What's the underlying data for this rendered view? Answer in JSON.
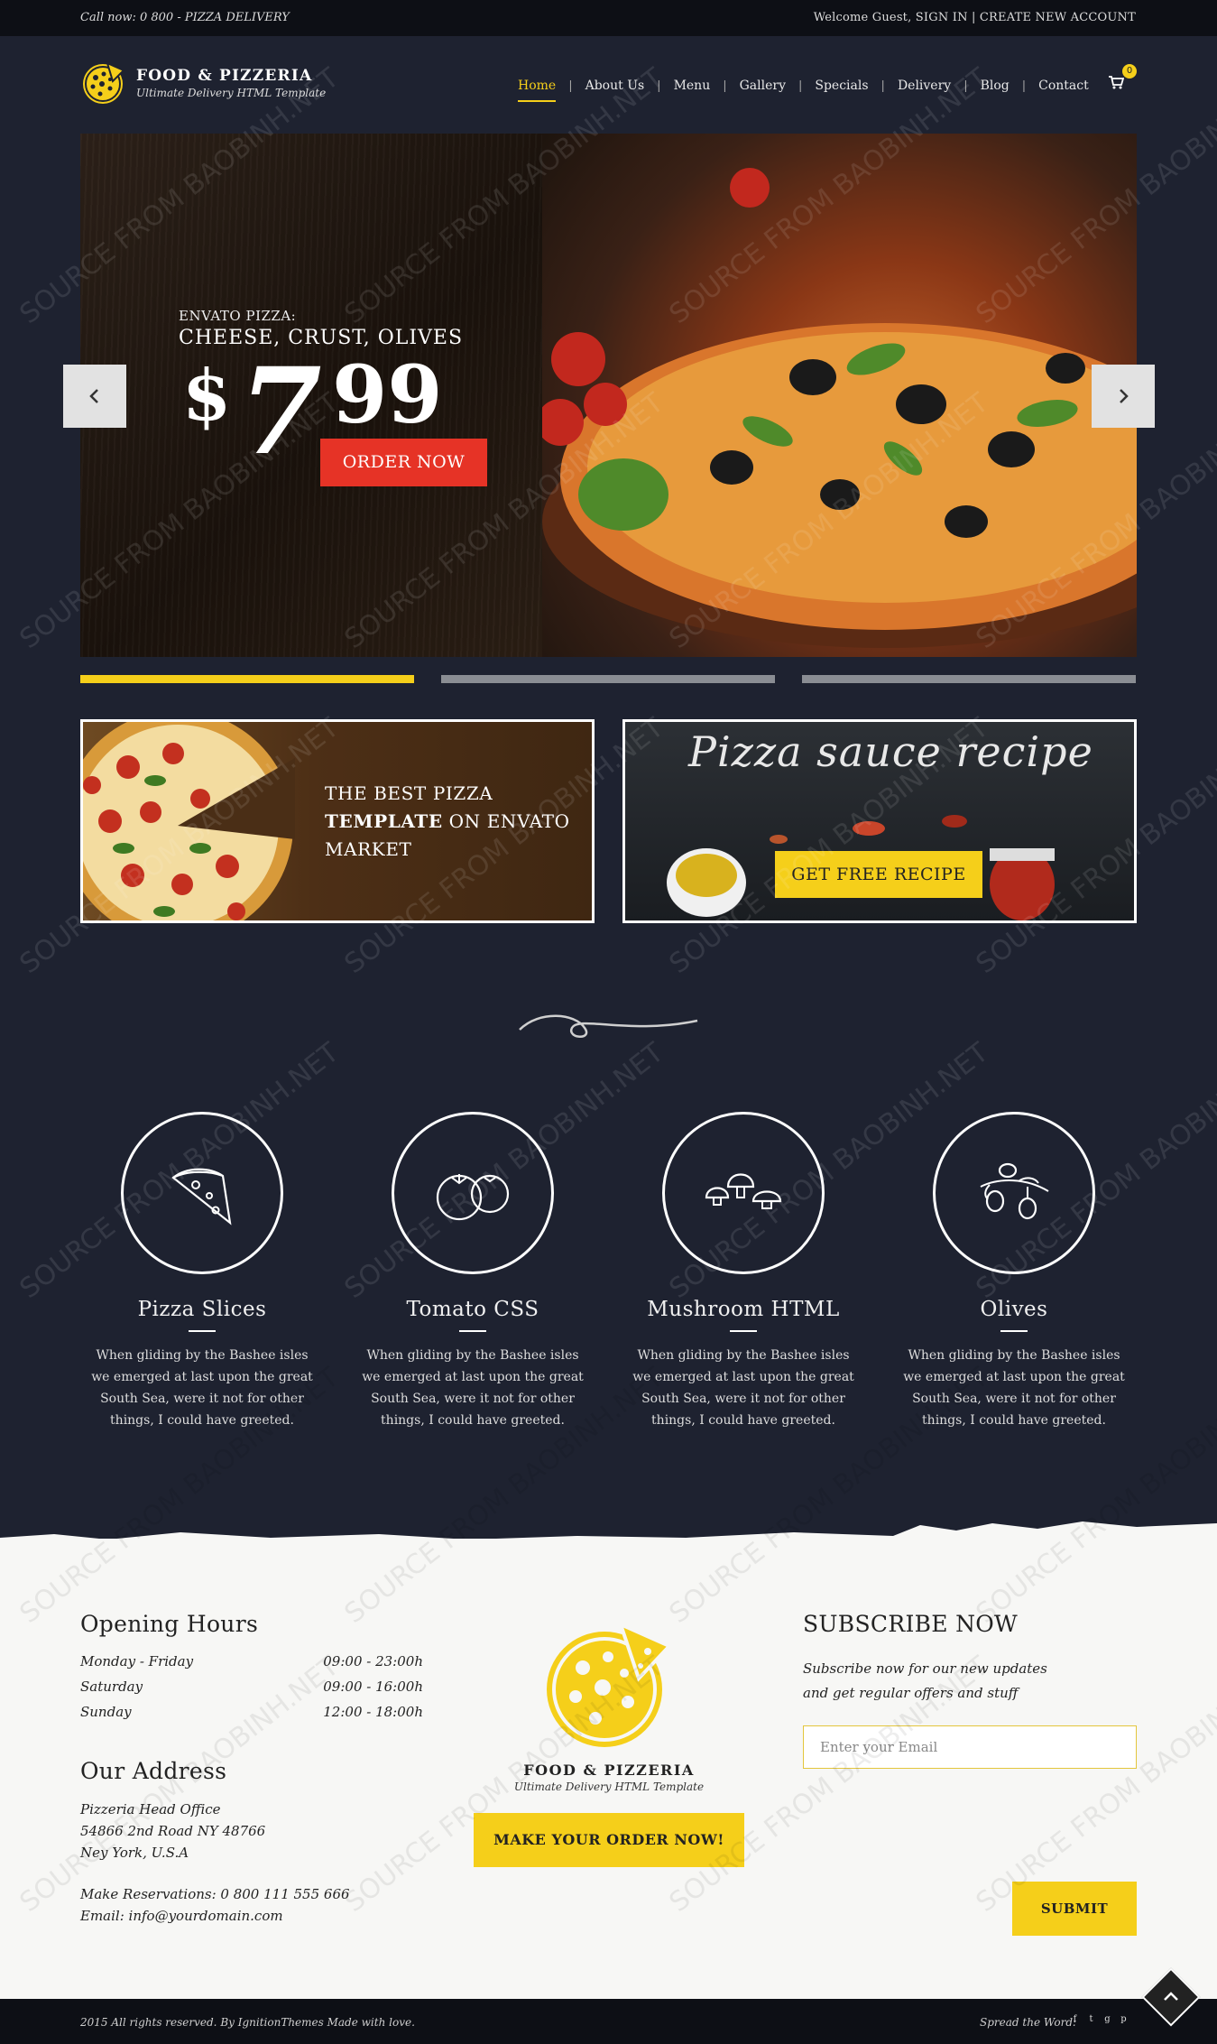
{
  "topbar": {
    "call": "Call now: 0 800 - PIZZA DELIVERY",
    "welcome": "Welcome Guest,",
    "sign_in": "SIGN IN",
    "separator": " | ",
    "create_account": "CREATE NEW ACCOUNT"
  },
  "header": {
    "brand_name": "FOOD & PIZZERIA",
    "brand_tagline": "Ultimate Delivery HTML Template",
    "nav": [
      "Home",
      "About Us",
      "Menu",
      "Gallery",
      "Specials",
      "Delivery",
      "Blog",
      "Contact"
    ],
    "active_nav": "Home",
    "cart_count": "0"
  },
  "hero": {
    "pretitle": "ENVATO PIZZA:",
    "title": "CHEESE, CRUST, OLIVES",
    "currency": "$",
    "price_main": "7",
    "price_cents": "99",
    "cta": "ORDER NOW",
    "active_slide": 1,
    "slide_count": 3
  },
  "promos": {
    "best_line1": "THE BEST PIZZA",
    "best_bold": "TEMPLATE",
    "best_rest": " ON ENVATO MARKET",
    "sauce_title": "Pizza sauce recipe",
    "sauce_cta": "GET FREE RECIPE"
  },
  "features": [
    {
      "title": "Pizza Slices",
      "text": "When gliding by the Bashee isles we emerged at last upon the great South Sea, were it not for other things, I could have greeted.",
      "icon": "pizza-slice-icon"
    },
    {
      "title": "Tomato CSS",
      "text": "When gliding by the Bashee isles we emerged at last upon the great South Sea, were it not for other things, I could have greeted.",
      "icon": "tomato-icon"
    },
    {
      "title": "Mushroom HTML",
      "text": "When gliding by the Bashee isles we emerged at last upon the great South Sea, were it not for other things, I could have greeted.",
      "icon": "mushroom-icon"
    },
    {
      "title": "Olives",
      "text": "When gliding by the Bashee isles we emerged at last upon the great South Sea, were it not for other things, I could have greeted.",
      "icon": "olives-icon"
    }
  ],
  "footer": {
    "opening_title": "Opening Hours",
    "hours": [
      {
        "day": "Monday - Friday",
        "time": "09:00 - 23:00h"
      },
      {
        "day": "Saturday",
        "time": "09:00 - 16:00h"
      },
      {
        "day": "Sunday",
        "time": "12:00 - 18:00h"
      }
    ],
    "address_title": "Our Address",
    "address_lines": [
      "Pizzeria Head Office",
      "54866 2nd Road NY 48766",
      "Ney York, U.S.A"
    ],
    "reservations": "Make Reservations: 0 800 111 555 666",
    "email": "Email: info@yourdomain.com",
    "brand_name": "FOOD & PIZZERIA",
    "brand_tagline": "Ultimate Delivery HTML Template",
    "order_cta": "MAKE YOUR ORDER NOW!",
    "subscribe_title": "SUBSCRIBE NOW",
    "subscribe_desc1": "Subscribe now for our new updates",
    "subscribe_desc2": "and get regular offers and stuff",
    "email_placeholder": "Enter your Email",
    "submit": "SUBMIT"
  },
  "bottombar": {
    "copyright": "2015 All rights reserved. By IgnitionThemes Made with love.",
    "spread": "Spread the Word:"
  },
  "watermark": "SOURCE FROM BAOBINH.NET",
  "colors": {
    "accent": "#f5cf1a",
    "order_red": "#e63326",
    "background": "#1e2230"
  }
}
